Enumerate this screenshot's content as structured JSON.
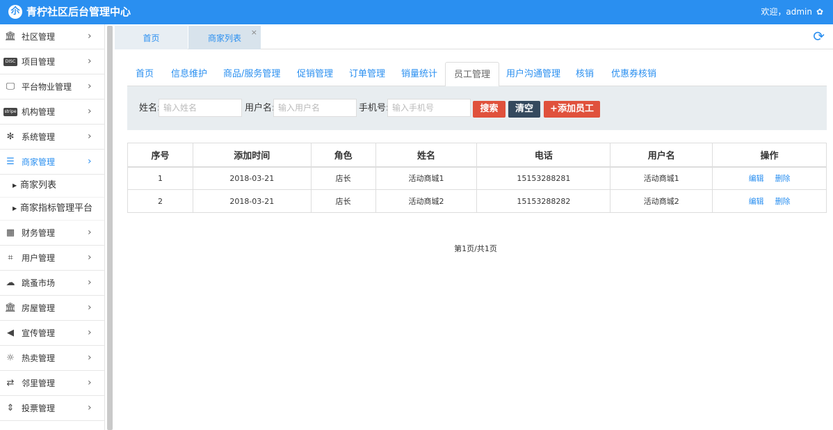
{
  "header": {
    "logo_glyph": "尒",
    "title": "青柠社区后台管理中心",
    "welcome": "欢迎，admin",
    "settings_icon": "gear-icon"
  },
  "sidebar": {
    "items": [
      {
        "label": "社区管理",
        "icon": "bank-icon"
      },
      {
        "label": "项目管理",
        "icon": "discover-icon"
      },
      {
        "label": "平台物业管理",
        "icon": "monitor-icon"
      },
      {
        "label": "机构管理",
        "icon": "stripe-icon"
      },
      {
        "label": "系统管理",
        "icon": "yelp-icon"
      },
      {
        "label": "商家管理",
        "icon": "list-icon",
        "active": true
      },
      {
        "label": "财务管理",
        "icon": "calculator-icon"
      },
      {
        "label": "用户管理",
        "icon": "crop-icon"
      },
      {
        "label": "跳蚤市场",
        "icon": "cloud-icon"
      },
      {
        "label": "房屋管理",
        "icon": "bank-icon"
      },
      {
        "label": "宣传管理",
        "icon": "volume-icon"
      },
      {
        "label": "热卖管理",
        "icon": "sun-icon"
      },
      {
        "label": "邻里管理",
        "icon": "retweet-icon"
      },
      {
        "label": "投票管理",
        "icon": "sort-icon"
      }
    ],
    "subitems": [
      {
        "label": "商家列表"
      },
      {
        "label": "商家指标管理平台"
      }
    ]
  },
  "page_tabs": [
    {
      "label": "首页"
    },
    {
      "label": "商家列表",
      "close": "×"
    }
  ],
  "nav_tabs": [
    {
      "label": "首页"
    },
    {
      "label": "信息维护"
    },
    {
      "label": "商品/服务管理"
    },
    {
      "label": "促销管理"
    },
    {
      "label": "订单管理"
    },
    {
      "label": "销量统计"
    },
    {
      "label": "员工管理",
      "active": true
    },
    {
      "label": "用户沟通管理"
    },
    {
      "label": "核销"
    },
    {
      "label": "优惠券核销"
    }
  ],
  "search": {
    "name_label": "姓名:",
    "name_placeholder": "输入姓名",
    "username_label": "用户名:",
    "username_placeholder": "输入用户名",
    "phone_label": "手机号:",
    "phone_placeholder": "输入手机号",
    "search_btn": "搜索",
    "clear_btn": "清空",
    "add_btn": "+添加员工"
  },
  "table": {
    "columns": [
      "序号",
      "添加时间",
      "角色",
      "姓名",
      "电话",
      "用户名",
      "操作"
    ],
    "rows": [
      {
        "no": "1",
        "date": "2018-03-21",
        "role": "店长",
        "name": "活动商城1",
        "phone": "15153288281",
        "username": "活动商城1",
        "edit": "编辑",
        "delete": "删除"
      },
      {
        "no": "2",
        "date": "2018-03-21",
        "role": "店长",
        "name": "活动商城2",
        "phone": "15153288282",
        "username": "活动商城2",
        "edit": "编辑",
        "delete": "删除"
      }
    ]
  },
  "pager": "第1页/共1页",
  "colors": {
    "primary": "#2a8ff0",
    "danger": "#e0513c",
    "dark": "#34495e",
    "panel": "#e8edf0"
  }
}
